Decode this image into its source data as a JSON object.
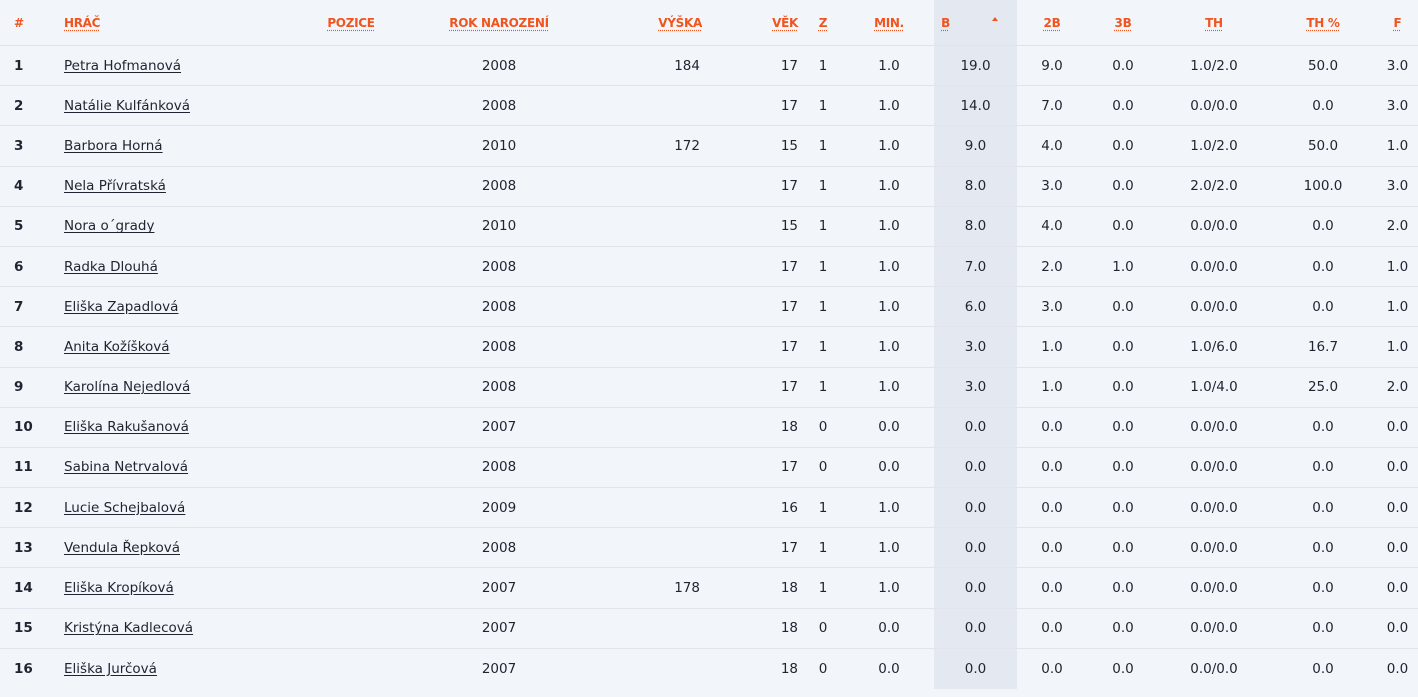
{
  "headers": {
    "rank": "#",
    "player": "HRÁČ",
    "position": "POZICE",
    "birth_year": "ROK NAROZENÍ",
    "height": "VÝŠKA",
    "age": "VĚK",
    "games": "Z",
    "minutes": "MIN.",
    "points": "B",
    "two_pt": "2B",
    "three_pt": "3B",
    "free_throws": "TH",
    "free_throw_pct": "TH %",
    "fouls": "F"
  },
  "sorted_column": "points",
  "rows": [
    {
      "rank": "1",
      "name": "Petra Hofmanová",
      "position": "",
      "birth_year": "2008",
      "height": "184",
      "age": "17",
      "games": "1",
      "minutes": "1.0",
      "points": "19.0",
      "two_pt": "9.0",
      "three_pt": "0.0",
      "free_throws": "1.0/2.0",
      "ft_pct": "50.0",
      "fouls": "3.0"
    },
    {
      "rank": "2",
      "name": "Natálie Kulfánková",
      "position": "",
      "birth_year": "2008",
      "height": "",
      "age": "17",
      "games": "1",
      "minutes": "1.0",
      "points": "14.0",
      "two_pt": "7.0",
      "three_pt": "0.0",
      "free_throws": "0.0/0.0",
      "ft_pct": "0.0",
      "fouls": "3.0"
    },
    {
      "rank": "3",
      "name": "Barbora Horná",
      "position": "",
      "birth_year": "2010",
      "height": "172",
      "age": "15",
      "games": "1",
      "minutes": "1.0",
      "points": "9.0",
      "two_pt": "4.0",
      "three_pt": "0.0",
      "free_throws": "1.0/2.0",
      "ft_pct": "50.0",
      "fouls": "1.0"
    },
    {
      "rank": "4",
      "name": "Nela Přívratská",
      "position": "",
      "birth_year": "2008",
      "height": "",
      "age": "17",
      "games": "1",
      "minutes": "1.0",
      "points": "8.0",
      "two_pt": "3.0",
      "three_pt": "0.0",
      "free_throws": "2.0/2.0",
      "ft_pct": "100.0",
      "fouls": "3.0"
    },
    {
      "rank": "5",
      "name": "Nora o´grady",
      "position": "",
      "birth_year": "2010",
      "height": "",
      "age": "15",
      "games": "1",
      "minutes": "1.0",
      "points": "8.0",
      "two_pt": "4.0",
      "three_pt": "0.0",
      "free_throws": "0.0/0.0",
      "ft_pct": "0.0",
      "fouls": "2.0"
    },
    {
      "rank": "6",
      "name": "Radka Dlouhá",
      "position": "",
      "birth_year": "2008",
      "height": "",
      "age": "17",
      "games": "1",
      "minutes": "1.0",
      "points": "7.0",
      "two_pt": "2.0",
      "three_pt": "1.0",
      "free_throws": "0.0/0.0",
      "ft_pct": "0.0",
      "fouls": "1.0"
    },
    {
      "rank": "7",
      "name": "Eliška Zapadlová",
      "position": "",
      "birth_year": "2008",
      "height": "",
      "age": "17",
      "games": "1",
      "minutes": "1.0",
      "points": "6.0",
      "two_pt": "3.0",
      "three_pt": "0.0",
      "free_throws": "0.0/0.0",
      "ft_pct": "0.0",
      "fouls": "1.0"
    },
    {
      "rank": "8",
      "name": "Anita Kožíšková",
      "position": "",
      "birth_year": "2008",
      "height": "",
      "age": "17",
      "games": "1",
      "minutes": "1.0",
      "points": "3.0",
      "two_pt": "1.0",
      "three_pt": "0.0",
      "free_throws": "1.0/6.0",
      "ft_pct": "16.7",
      "fouls": "1.0"
    },
    {
      "rank": "9",
      "name": "Karolína Nejedlová",
      "position": "",
      "birth_year": "2008",
      "height": "",
      "age": "17",
      "games": "1",
      "minutes": "1.0",
      "points": "3.0",
      "two_pt": "1.0",
      "three_pt": "0.0",
      "free_throws": "1.0/4.0",
      "ft_pct": "25.0",
      "fouls": "2.0"
    },
    {
      "rank": "10",
      "name": "Eliška Rakušanová",
      "position": "",
      "birth_year": "2007",
      "height": "",
      "age": "18",
      "games": "0",
      "minutes": "0.0",
      "points": "0.0",
      "two_pt": "0.0",
      "three_pt": "0.0",
      "free_throws": "0.0/0.0",
      "ft_pct": "0.0",
      "fouls": "0.0"
    },
    {
      "rank": "11",
      "name": "Sabina Netrvalová",
      "position": "",
      "birth_year": "2008",
      "height": "",
      "age": "17",
      "games": "0",
      "minutes": "0.0",
      "points": "0.0",
      "two_pt": "0.0",
      "three_pt": "0.0",
      "free_throws": "0.0/0.0",
      "ft_pct": "0.0",
      "fouls": "0.0"
    },
    {
      "rank": "12",
      "name": "Lucie Schejbalová",
      "position": "",
      "birth_year": "2009",
      "height": "",
      "age": "16",
      "games": "1",
      "minutes": "1.0",
      "points": "0.0",
      "two_pt": "0.0",
      "three_pt": "0.0",
      "free_throws": "0.0/0.0",
      "ft_pct": "0.0",
      "fouls": "0.0"
    },
    {
      "rank": "13",
      "name": "Vendula Řepková",
      "position": "",
      "birth_year": "2008",
      "height": "",
      "age": "17",
      "games": "1",
      "minutes": "1.0",
      "points": "0.0",
      "two_pt": "0.0",
      "three_pt": "0.0",
      "free_throws": "0.0/0.0",
      "ft_pct": "0.0",
      "fouls": "0.0"
    },
    {
      "rank": "14",
      "name": "Eliška Kropíková",
      "position": "",
      "birth_year": "2007",
      "height": "178",
      "age": "18",
      "games": "1",
      "minutes": "1.0",
      "points": "0.0",
      "two_pt": "0.0",
      "three_pt": "0.0",
      "free_throws": "0.0/0.0",
      "ft_pct": "0.0",
      "fouls": "0.0"
    },
    {
      "rank": "15",
      "name": "Kristýna Kadlecová",
      "position": "",
      "birth_year": "2007",
      "height": "",
      "age": "18",
      "games": "0",
      "minutes": "0.0",
      "points": "0.0",
      "two_pt": "0.0",
      "three_pt": "0.0",
      "free_throws": "0.0/0.0",
      "ft_pct": "0.0",
      "fouls": "0.0"
    },
    {
      "rank": "16",
      "name": "Eliška Jurčová",
      "position": "",
      "birth_year": "2007",
      "height": "",
      "age": "18",
      "games": "0",
      "minutes": "0.0",
      "points": "0.0",
      "two_pt": "0.0",
      "three_pt": "0.0",
      "free_throws": "0.0/0.0",
      "ft_pct": "0.0",
      "fouls": "0.0"
    }
  ]
}
